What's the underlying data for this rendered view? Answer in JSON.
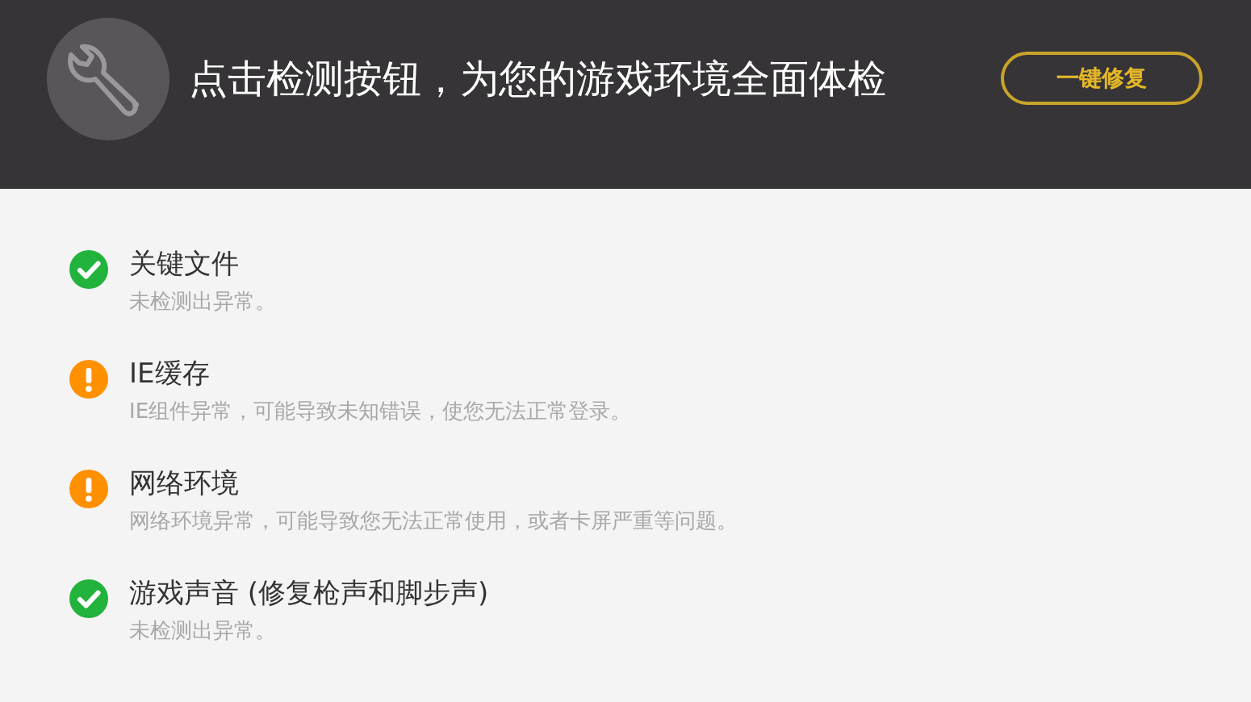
{
  "header": {
    "title": "点击检测按钮，为您的游戏环境全面体检",
    "fix_button": "一键修复"
  },
  "checks": [
    {
      "kind": "ok",
      "title": "关键文件",
      "description": "未检测出异常。"
    },
    {
      "kind": "warning",
      "title": "IE缓存",
      "description": "IE组件异常，可能导致未知错误，使您无法正常登录。"
    },
    {
      "kind": "warning",
      "title": "网络环境",
      "description": "网络环境异常，可能导致您无法正常使用，或者卡屏严重等问题。"
    },
    {
      "kind": "ok",
      "title": "游戏声音 (修复枪声和脚步声)",
      "description": "未检测出异常。"
    }
  ]
}
